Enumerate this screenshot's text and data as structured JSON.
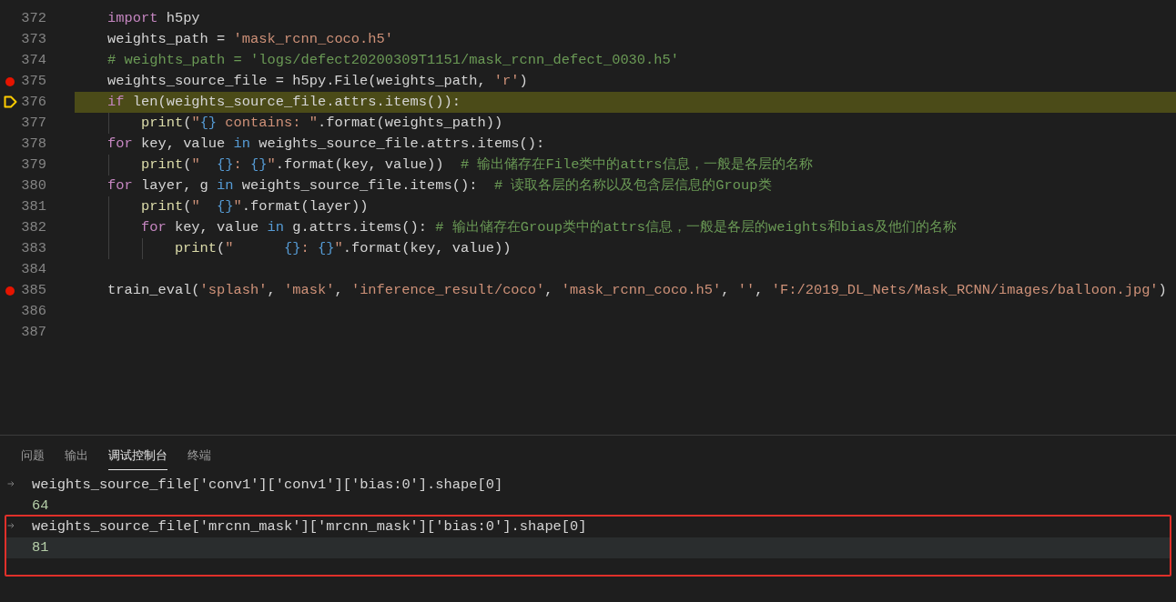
{
  "editor": {
    "lines": [
      {
        "number": "372",
        "breakpoint": false,
        "current": false,
        "tokens": [
          {
            "text": "import",
            "kind": "keyword"
          },
          {
            "text": " h5py",
            "kind": "plain"
          }
        ]
      },
      {
        "number": "373",
        "breakpoint": false,
        "current": false,
        "tokens": [
          {
            "text": "weights_path = ",
            "kind": "plain"
          },
          {
            "text": "'mask_rcnn_coco.h5'",
            "kind": "string"
          }
        ]
      },
      {
        "number": "374",
        "breakpoint": false,
        "current": false,
        "tokens": [
          {
            "text": "# weights_path = 'logs/defect20200309T1151/mask_rcnn_defect_0030.h5'",
            "kind": "comment"
          }
        ]
      },
      {
        "number": "375",
        "breakpoint": true,
        "current": false,
        "tokens": [
          {
            "text": "weights_source_file = h5py.File(weights_path, ",
            "kind": "plain"
          },
          {
            "text": "'r'",
            "kind": "string"
          },
          {
            "text": ")",
            "kind": "plain"
          }
        ]
      },
      {
        "number": "376",
        "breakpoint": false,
        "current": true,
        "tokens": [
          {
            "text": "if",
            "kind": "keyword"
          },
          {
            "text": " len(weights_source_file.attrs.items()):",
            "kind": "plain"
          }
        ]
      },
      {
        "number": "377",
        "breakpoint": false,
        "current": false,
        "tokens": [
          {
            "text": "    print",
            "kind": "function"
          },
          {
            "text": "(",
            "kind": "plain"
          },
          {
            "text": "\"",
            "kind": "string"
          },
          {
            "text": "{}",
            "kind": "brace"
          },
          {
            "text": " contains: \"",
            "kind": "string"
          },
          {
            "text": ".format(weights_path))",
            "kind": "plain"
          }
        ]
      },
      {
        "number": "378",
        "breakpoint": false,
        "current": false,
        "tokens": [
          {
            "text": "for",
            "kind": "keyword"
          },
          {
            "text": " key, value ",
            "kind": "plain"
          },
          {
            "text": "in",
            "kind": "operator"
          },
          {
            "text": " weights_source_file.attrs.items():",
            "kind": "plain"
          }
        ]
      },
      {
        "number": "379",
        "breakpoint": false,
        "current": false,
        "tokens": [
          {
            "text": "    print",
            "kind": "function"
          },
          {
            "text": "(",
            "kind": "plain"
          },
          {
            "text": "\"  ",
            "kind": "string"
          },
          {
            "text": "{}",
            "kind": "brace"
          },
          {
            "text": ": ",
            "kind": "string"
          },
          {
            "text": "{}",
            "kind": "brace"
          },
          {
            "text": "\"",
            "kind": "string"
          },
          {
            "text": ".format(key, value))  ",
            "kind": "plain"
          },
          {
            "text": "# 输出储存在File类中的attrs信息，一般是各层的名称",
            "kind": "comment"
          }
        ]
      },
      {
        "number": "380",
        "breakpoint": false,
        "current": false,
        "tokens": [
          {
            "text": "for",
            "kind": "keyword"
          },
          {
            "text": " layer, g ",
            "kind": "plain"
          },
          {
            "text": "in",
            "kind": "operator"
          },
          {
            "text": " weights_source_file.items():  ",
            "kind": "plain"
          },
          {
            "text": "# 读取各层的名称以及包含层信息的Group类",
            "kind": "comment"
          }
        ]
      },
      {
        "number": "381",
        "breakpoint": false,
        "current": false,
        "tokens": [
          {
            "text": "    print",
            "kind": "function"
          },
          {
            "text": "(",
            "kind": "plain"
          },
          {
            "text": "\"  ",
            "kind": "string"
          },
          {
            "text": "{}",
            "kind": "brace"
          },
          {
            "text": "\"",
            "kind": "string"
          },
          {
            "text": ".format(layer))",
            "kind": "plain"
          }
        ]
      },
      {
        "number": "382",
        "breakpoint": false,
        "current": false,
        "tokens": [
          {
            "text": "    for",
            "kind": "keyword"
          },
          {
            "text": " key, value ",
            "kind": "plain"
          },
          {
            "text": "in",
            "kind": "operator"
          },
          {
            "text": " g.attrs.items(): ",
            "kind": "plain"
          },
          {
            "text": "# 输出储存在Group类中的attrs信息，一般是各层的weights和bias及他们的名称",
            "kind": "comment"
          }
        ]
      },
      {
        "number": "383",
        "breakpoint": false,
        "current": false,
        "tokens": [
          {
            "text": "        print",
            "kind": "function"
          },
          {
            "text": "(",
            "kind": "plain"
          },
          {
            "text": "\"      ",
            "kind": "string"
          },
          {
            "text": "{}",
            "kind": "brace"
          },
          {
            "text": ": ",
            "kind": "string"
          },
          {
            "text": "{}",
            "kind": "brace"
          },
          {
            "text": "\"",
            "kind": "string"
          },
          {
            "text": ".format(key, value))",
            "kind": "plain"
          }
        ]
      },
      {
        "number": "384",
        "breakpoint": false,
        "current": false
      },
      {
        "number": "385",
        "breakpoint": true,
        "current": false,
        "tokens": [
          {
            "text": "train_eval(",
            "kind": "plain"
          },
          {
            "text": "'splash'",
            "kind": "string"
          },
          {
            "text": ", ",
            "kind": "plain"
          },
          {
            "text": "'mask'",
            "kind": "string"
          },
          {
            "text": ", ",
            "kind": "plain"
          },
          {
            "text": "'inference_result/coco'",
            "kind": "string"
          },
          {
            "text": ", ",
            "kind": "plain"
          },
          {
            "text": "'mask_rcnn_coco.h5'",
            "kind": "string"
          },
          {
            "text": ", ",
            "kind": "plain"
          },
          {
            "text": "''",
            "kind": "string"
          },
          {
            "text": ", ",
            "kind": "plain"
          },
          {
            "text": "'F:/2019_DL_Nets/Mask_RCNN/images/balloon.jpg'",
            "kind": "string"
          },
          {
            "text": ")",
            "kind": "plain"
          }
        ]
      },
      {
        "number": "386",
        "breakpoint": false,
        "current": false
      },
      {
        "number": "387",
        "breakpoint": false,
        "current": false
      }
    ]
  },
  "panel": {
    "tabs": [
      {
        "label": "问题",
        "selected": false
      },
      {
        "label": "输出",
        "selected": false
      },
      {
        "label": "调试控制台",
        "selected": true
      },
      {
        "label": "终端",
        "selected": false
      }
    ],
    "console": [
      {
        "kind": "input",
        "text": "weights_source_file['conv1']['conv1']['bias:0'].shape[0]",
        "selected": false,
        "highlighted": false
      },
      {
        "kind": "output",
        "text": "64",
        "selected": false,
        "highlighted": false
      },
      {
        "kind": "input",
        "text": "weights_source_file['mrcnn_mask']['mrcnn_mask']['bias:0'].shape[0]",
        "selected": false,
        "highlighted": true
      },
      {
        "kind": "output",
        "text": "81",
        "selected": true,
        "highlighted": true
      }
    ]
  }
}
